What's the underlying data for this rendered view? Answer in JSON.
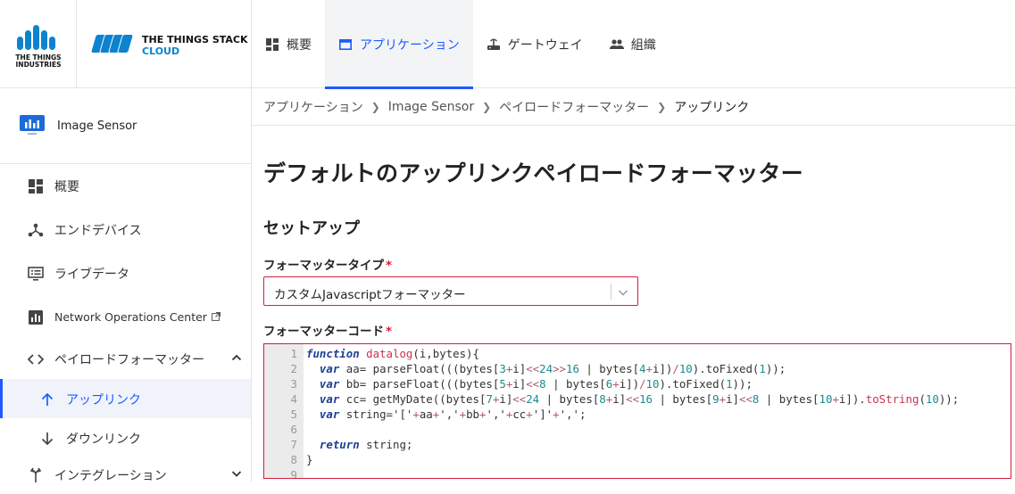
{
  "brand": {
    "tti_line1": "THE THINGS",
    "tti_line2": "INDUSTRIES",
    "tts_title": "THE THINGS STACK",
    "tts_sub": "CLOUD",
    "accent": "#1c5bff",
    "logo_blue": "#0d83d0",
    "error_red": "#d21f3c"
  },
  "topnav": [
    {
      "label": "概要",
      "icon": "dashboard-icon"
    },
    {
      "label": "アプリケーション",
      "icon": "application-icon",
      "active": true
    },
    {
      "label": "ゲートウェイ",
      "icon": "router-icon"
    },
    {
      "label": "組織",
      "icon": "people-icon"
    }
  ],
  "sidebar": {
    "app_name": "Image Sensor",
    "items": [
      {
        "label": "概要",
        "icon": "dashboard-icon"
      },
      {
        "label": "エンドデバイス",
        "icon": "device-hub-icon"
      },
      {
        "label": "ライブデータ",
        "icon": "list-alt-icon"
      },
      {
        "label": "Network Operations Center",
        "icon": "bar-chart-icon",
        "external": true
      },
      {
        "label": "ペイロードフォーマッター",
        "icon": "code-icon",
        "expanded": true
      },
      {
        "label": "アップリンク",
        "icon": "arrow-up-icon",
        "active": true
      },
      {
        "label": "ダウンリンク",
        "icon": "arrow-down-icon"
      },
      {
        "label": "インテグレーション",
        "icon": "merge-icon"
      }
    ]
  },
  "breadcrumb": [
    "アプリケーション",
    "Image Sensor",
    "ペイロードフォーマッター",
    "アップリンク"
  ],
  "main": {
    "title": "デフォルトのアップリンクペイロードフォーマッター",
    "section": "セットアップ",
    "formatter_type_label": "フォーマッタータイプ",
    "formatter_type_value": "カスタムJavascriptフォーマッター",
    "formatter_code_label": "フォーマッターコード",
    "required_mark": "*"
  },
  "code": {
    "line_numbers": [
      "1",
      "2",
      "3",
      "4",
      "5",
      "6",
      "7",
      "8",
      "9"
    ],
    "lines": [
      "function datalog(i,bytes){",
      "  var aa= parseFloat(((bytes[3+i]<<24>>16 | bytes[4+i])/10).toFixed(1));",
      "  var bb= parseFloat(((bytes[5+i]<<8 | bytes[6+i])/10).toFixed(1));",
      "  var cc= getMyDate((bytes[7+i]<<24 | bytes[8+i]<<16 | bytes[9+i]<<8 | bytes[10+i]).toString(10));",
      "  var string='['+aa+','+bb+','+cc+']'+',';",
      "",
      "  return string;",
      "}",
      ""
    ]
  }
}
